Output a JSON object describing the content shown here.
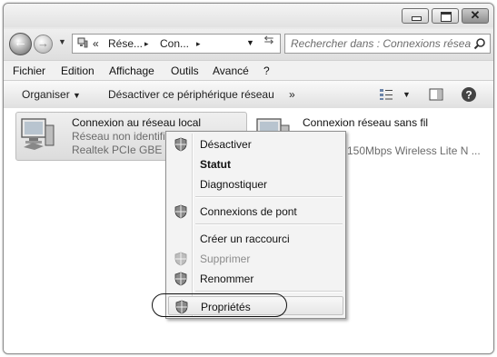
{
  "window": {
    "buttons": {
      "minimize": "minimize",
      "maximize": "maximize",
      "close": "✕"
    }
  },
  "address": {
    "chevrons": "«",
    "segments": [
      "Rése...",
      "Con..."
    ],
    "separator": "▸"
  },
  "search": {
    "placeholder": "Rechercher dans : Connexions réseau"
  },
  "menubar": [
    "Fichier",
    "Edition",
    "Affichage",
    "Outils",
    "Avancé",
    "?"
  ],
  "toolbar": {
    "organize": "Organiser",
    "disable": "Désactiver ce périphérique réseau",
    "more": "»"
  },
  "items": [
    {
      "name": "Connexion au réseau local",
      "status": "Réseau non identifié",
      "device": "Realtek PCIe GBE Fam"
    },
    {
      "name": "Connexion réseau sans fil",
      "device": "150Mbps Wireless Lite N ..."
    }
  ],
  "context_menu": [
    {
      "label": "Désactiver",
      "shield": true
    },
    {
      "label": "Statut",
      "bold": true
    },
    {
      "label": "Diagnostiquer"
    },
    {
      "label": "Connexions de pont",
      "shield": true
    },
    {
      "label": "Créer un raccourci"
    },
    {
      "label": "Supprimer",
      "shield": true,
      "disabled": true
    },
    {
      "label": "Renommer",
      "shield": true
    },
    {
      "label": "Propriétés",
      "shield": true,
      "selected": true
    }
  ],
  "colors": {
    "accent": "#1a1a1a",
    "disabled": "#8c8c8c",
    "background": "#e9e9e9"
  }
}
